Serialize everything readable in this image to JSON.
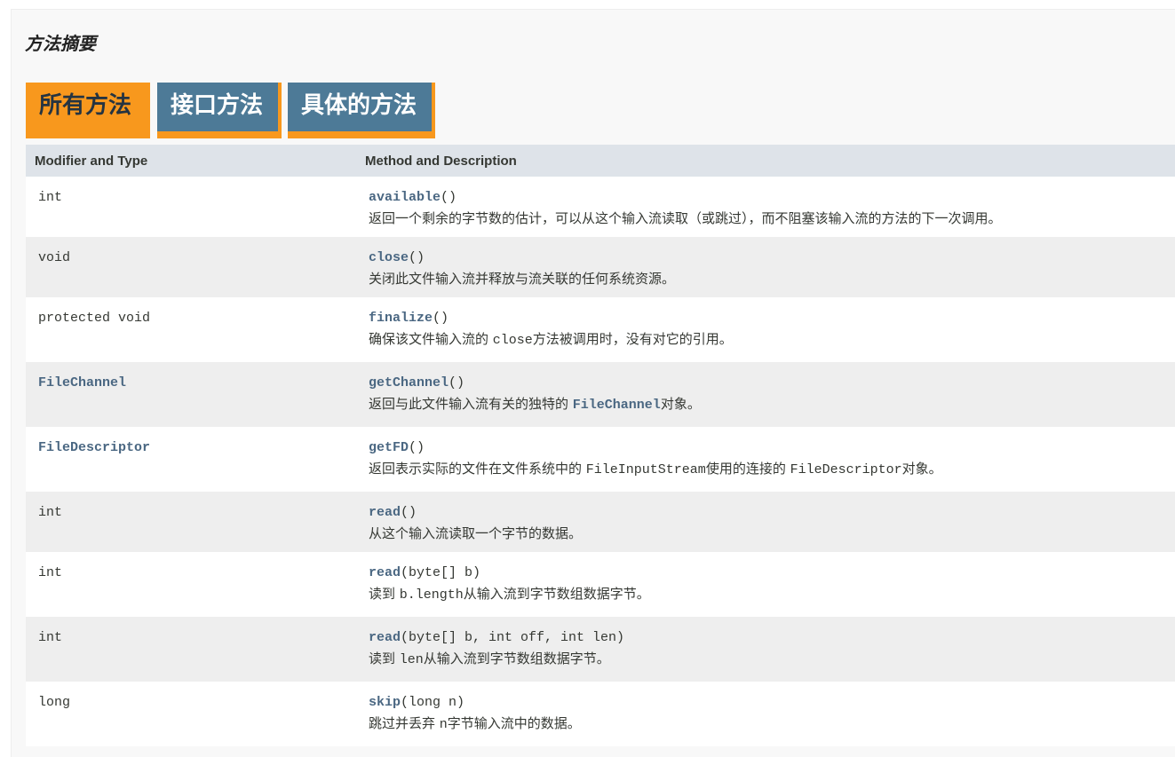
{
  "section": {
    "title": "方法摘要"
  },
  "tabs": [
    {
      "label": "所有方法",
      "active": true
    },
    {
      "label": "接口方法",
      "active": false
    },
    {
      "label": "具体的方法",
      "active": false
    }
  ],
  "table": {
    "headers": {
      "type": "Modifier and Type",
      "method": "Method and Description"
    },
    "rows": [
      {
        "type": "int",
        "type_is_link": false,
        "method_name": "available",
        "params": "()",
        "desc_before": "返回一个剩余的字节数的估计，可以从这个输入流读取（或跳过），而不阻塞该输入流的方法的下一次调用。",
        "desc_code": "",
        "desc_after": ""
      },
      {
        "type": "void",
        "type_is_link": false,
        "method_name": "close",
        "params": "()",
        "desc_before": "关闭此文件输入流并释放与流关联的任何系统资源。",
        "desc_code": "",
        "desc_after": ""
      },
      {
        "type": "protected void",
        "type_is_link": false,
        "method_name": "finalize",
        "params": "()",
        "desc_before": "确保该文件输入流的 ",
        "desc_code": "close",
        "desc_after": "方法被调用时，没有对它的引用。"
      },
      {
        "type": "FileChannel",
        "type_is_link": true,
        "method_name": "getChannel",
        "params": "()",
        "desc_before": "返回与此文件输入流有关的独特的 ",
        "desc_code": "FileChannel",
        "desc_after": "对象。"
      },
      {
        "type": "FileDescriptor",
        "type_is_link": true,
        "method_name": "getFD",
        "params": "()",
        "desc_before": "返回表示实际的文件在文件系统中的 ",
        "desc_code": "FileInputStream",
        "desc_mid": "使用的连接的 ",
        "desc_code2": "FileDescriptor",
        "desc_after": "对象。"
      },
      {
        "type": "int",
        "type_is_link": false,
        "method_name": "read",
        "params": "()",
        "desc_before": "从这个输入流读取一个字节的数据。",
        "desc_code": "",
        "desc_after": ""
      },
      {
        "type": "int",
        "type_is_link": false,
        "method_name": "read",
        "params": "(byte[] b)",
        "desc_before": "读到 ",
        "desc_code": "b.length",
        "desc_after": "从输入流到字节数组数据字节。"
      },
      {
        "type": "int",
        "type_is_link": false,
        "method_name": "read",
        "params": "(byte[] b, int off, int len)",
        "desc_before": "读到 ",
        "desc_code": "len",
        "desc_after": "从输入流到字节数组数据字节。"
      },
      {
        "type": "long",
        "type_is_link": false,
        "method_name": "skip",
        "params": "(long n)",
        "desc_before": "跳过并丢弃 ",
        "desc_code": "n",
        "desc_after": "字节输入流中的数据。"
      }
    ]
  },
  "colors": {
    "tab_active": "#f8981d",
    "tab_inactive": "#4d7a97",
    "header_bg": "#dee3e9",
    "row_alt": "#eeeeee",
    "link": "#4a6782"
  }
}
